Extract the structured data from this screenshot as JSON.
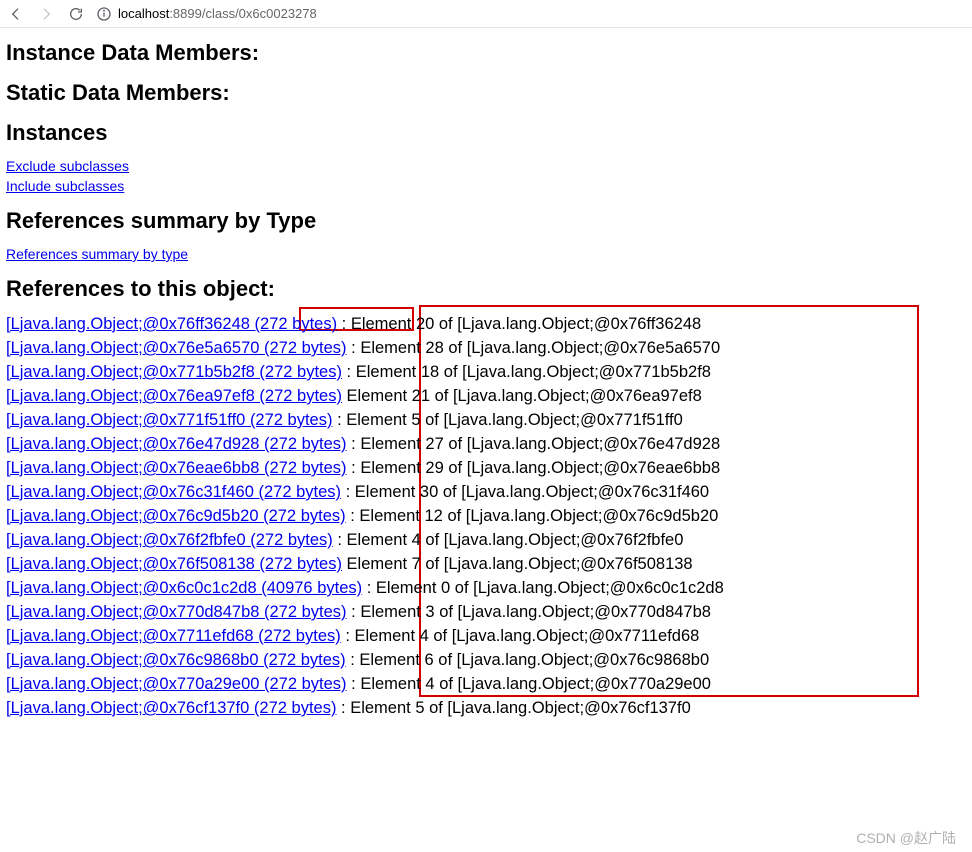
{
  "toolbar": {
    "url_host": "localhost",
    "url_port_path": ":8899/class/0x6c0023278"
  },
  "headings": {
    "instance_data": "Instance Data Members:",
    "static_data": "Static Data Members:",
    "instances": "Instances",
    "ref_summary_type": "References summary by Type",
    "ref_to_object": "References to this object:"
  },
  "links": {
    "exclude_sub": "Exclude subclasses",
    "include_sub": "Include subclasses",
    "ref_summary": "References summary by type"
  },
  "refs": [
    {
      "link": "[Ljava.lang.Object;@0x76ff36248 (272 bytes)",
      "desc": " : Element 20 of [Ljava.lang.Object;@0x76ff36248"
    },
    {
      "link": "[Ljava.lang.Object;@0x76e5a6570 (272 bytes)",
      "desc": " : Element 28 of [Ljava.lang.Object;@0x76e5a6570"
    },
    {
      "link": "[Ljava.lang.Object;@0x771b5b2f8 (272 bytes)",
      "desc": " : Element 18 of [Ljava.lang.Object;@0x771b5b2f8"
    },
    {
      "link": "[Ljava.lang.Object;@0x76ea97ef8 (272 bytes)",
      "desc": "  Element 21 of [Ljava.lang.Object;@0x76ea97ef8"
    },
    {
      "link": "[Ljava.lang.Object;@0x771f51ff0 (272 bytes)",
      "desc": " : Element 5 of [Ljava.lang.Object;@0x771f51ff0"
    },
    {
      "link": "[Ljava.lang.Object;@0x76e47d928 (272 bytes)",
      "desc": " : Element 27 of [Ljava.lang.Object;@0x76e47d928"
    },
    {
      "link": "[Ljava.lang.Object;@0x76eae6bb8 (272 bytes)",
      "desc": " : Element 29 of [Ljava.lang.Object;@0x76eae6bb8"
    },
    {
      "link": "[Ljava.lang.Object;@0x76c31f460 (272 bytes)",
      "desc": " : Element 30 of [Ljava.lang.Object;@0x76c31f460"
    },
    {
      "link": "[Ljava.lang.Object;@0x76c9d5b20 (272 bytes)",
      "desc": " : Element 12 of [Ljava.lang.Object;@0x76c9d5b20"
    },
    {
      "link": "[Ljava.lang.Object;@0x76f2fbfe0 (272 bytes)",
      "desc": " : Element 4 of [Ljava.lang.Object;@0x76f2fbfe0"
    },
    {
      "link": "[Ljava.lang.Object;@0x76f508138 (272 bytes)",
      "desc": "  Element 7 of [Ljava.lang.Object;@0x76f508138"
    },
    {
      "link": "[Ljava.lang.Object;@0x6c0c1c2d8 (40976 bytes)",
      "desc": " : Element 0 of [Ljava.lang.Object;@0x6c0c1c2d8"
    },
    {
      "link": "[Ljava.lang.Object;@0x770d847b8 (272 bytes)",
      "desc": " : Element 3 of [Ljava.lang.Object;@0x770d847b8"
    },
    {
      "link": "[Ljava.lang.Object;@0x7711efd68 (272 bytes)",
      "desc": " : Element 4 of [Ljava.lang.Object;@0x7711efd68"
    },
    {
      "link": "[Ljava.lang.Object;@0x76c9868b0 (272 bytes)",
      "desc": " : Element 6 of [Ljava.lang.Object;@0x76c9868b0"
    },
    {
      "link": "[Ljava.lang.Object;@0x770a29e00 (272 bytes)",
      "desc": " : Element 4 of [Ljava.lang.Object;@0x770a29e00"
    },
    {
      "link": "[Ljava.lang.Object;@0x76cf137f0 (272 bytes)",
      "desc": " : Element 5 of [Ljava.lang.Object;@0x76cf137f0"
    }
  ],
  "watermark": "CSDN @赵广陆"
}
